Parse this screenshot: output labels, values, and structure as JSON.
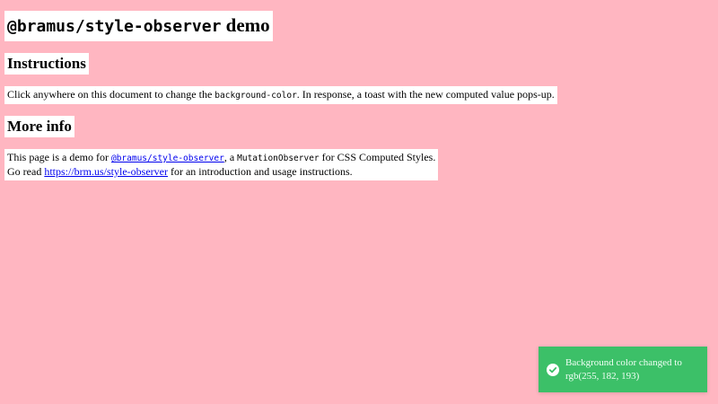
{
  "title": {
    "package": "@bramus/style-observer",
    "suffix": " demo"
  },
  "instructions": {
    "heading": "Instructions",
    "text_before": "Click anywhere on this document to change the ",
    "code": "background-color",
    "text_after": ". In response, a toast with the new computed value pops-up."
  },
  "more_info": {
    "heading": "More info",
    "line1_before": "This page is a demo for ",
    "line1_link": "@bramus/style-observer",
    "line1_middle": ", a ",
    "line1_code": "MutationObserver",
    "line1_after": " for CSS Computed Styles.",
    "line2_before": "Go read ",
    "line2_link": "https://brm.us/style-observer",
    "line2_after": " for an introduction and usage instructions."
  },
  "toast": {
    "line1": "Background color changed to",
    "line2": "rgb(255, 182, 193)",
    "icon": "check-circle-icon",
    "background": "#3cc068"
  },
  "colors": {
    "page_background": "#ffb6c1"
  }
}
